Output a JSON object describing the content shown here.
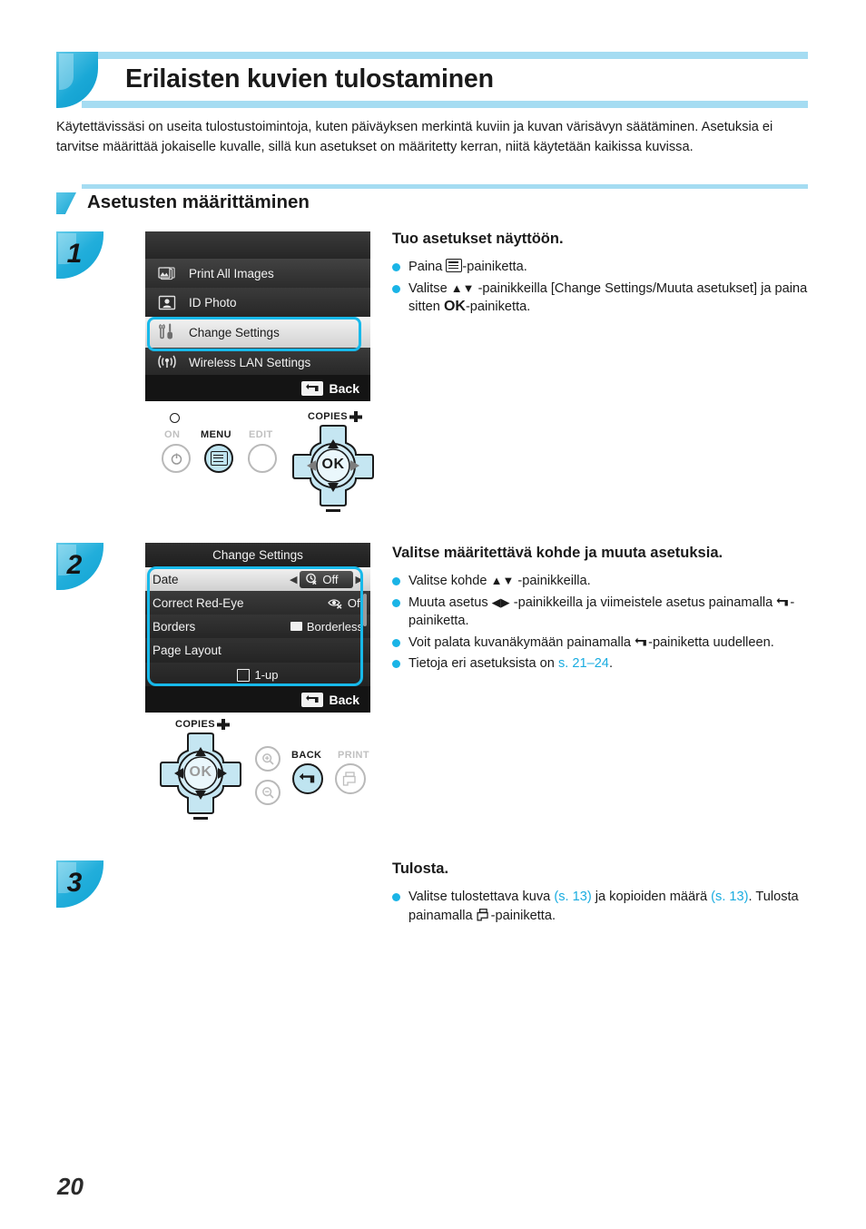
{
  "page": {
    "title": "Erilaisten kuvien tulostaminen",
    "intro": "Käytettävissäsi on useita tulostustoimintoja, kuten päiväyksen merkintä kuviin ja kuvan värisävyn säätäminen. Asetuksia ei tarvitse määrittää jokaiselle kuvalle, sillä kun asetukset on määritetty kerran, niitä käytetään kaikissa kuvissa.",
    "number": "20",
    "accent_color": "#1ab4e6",
    "band_color": "#a5dcf2",
    "link_color": "#1aace0"
  },
  "section": {
    "heading": "Asetusten määrittäminen"
  },
  "steps": [
    {
      "number": "1",
      "title": "Tuo asetukset näyttöön.",
      "bullets": [
        {
          "pre": "Paina ",
          "icon": "menu-icon",
          "post": "-painiketta."
        },
        {
          "pre": "Valitse ",
          "icon": "up-down-arrows",
          "post": " -painikkeilla [Change Settings/Muuta asetukset] ja paina sitten ",
          "key": "OK",
          "tail": "-painiketta."
        }
      ]
    },
    {
      "number": "2",
      "title": "Valitse määritettävä kohde ja muuta asetuksia.",
      "bullets": [
        {
          "pre": "Valitse kohde ",
          "icon": "up-down-arrows",
          "post": " -painikkeilla."
        },
        {
          "pre": "Muuta asetus ",
          "icon": "left-right-arrows",
          "post": " -painikkeilla ja viimeistele asetus painamalla ",
          "icon2": "back-icon",
          "tail": "-painiketta."
        },
        {
          "pre": "Voit palata kuvanäkymään painamalla ",
          "icon": "back-icon",
          "post": "-painiketta uudelleen."
        },
        {
          "pre": "Tietoja eri asetuksista on ",
          "link": "s. 21–24",
          "post": "."
        }
      ]
    },
    {
      "number": "3",
      "title": "Tulosta.",
      "bullets": [
        {
          "pre": "Valitse tulostettava kuva ",
          "link": "(s. 13)",
          "mid": " ja kopioiden määrä ",
          "link2": "(s. 13)",
          "post": ". Tulosta painamalla ",
          "icon": "print-icon",
          "tail": "-painiketta."
        }
      ]
    }
  ],
  "lcd_step1": {
    "items": [
      {
        "icon": "print-all-images-icon",
        "label": "Print All Images",
        "selected": false
      },
      {
        "icon": "id-photo-icon",
        "label": "ID Photo",
        "selected": false
      },
      {
        "icon": "tools-icon",
        "label": "Change Settings",
        "selected": true
      },
      {
        "icon": "wireless-lan-icon",
        "label": "Wireless LAN Settings",
        "selected": false
      }
    ],
    "back_label": "Back"
  },
  "lcd_step2": {
    "title": "Change Settings",
    "rows": [
      {
        "label": "Date",
        "value": "Off",
        "value_icon": "date-off-icon",
        "selected": true
      },
      {
        "label": "Correct Red-Eye",
        "value": "Off",
        "value_icon": "red-eye-off-icon",
        "selected": false
      },
      {
        "label": "Borders",
        "value": "Borderless",
        "value_icon": "borderless-icon",
        "selected": false
      },
      {
        "label": "Page Layout",
        "value": "",
        "value_icon": "",
        "selected": false
      },
      {
        "label": "",
        "value": "1-up",
        "value_icon": "one-up-icon",
        "selected": false
      }
    ],
    "back_label": "Back"
  },
  "buttons_step1": {
    "on_label": "ON",
    "menu_label": "MENU",
    "edit_label": "EDIT",
    "copies_label": "COPIES",
    "ok_label": "OK"
  },
  "buttons_step2": {
    "copies_label": "COPIES",
    "ok_label": "OK",
    "back_label": "BACK",
    "print_label": "PRINT"
  }
}
